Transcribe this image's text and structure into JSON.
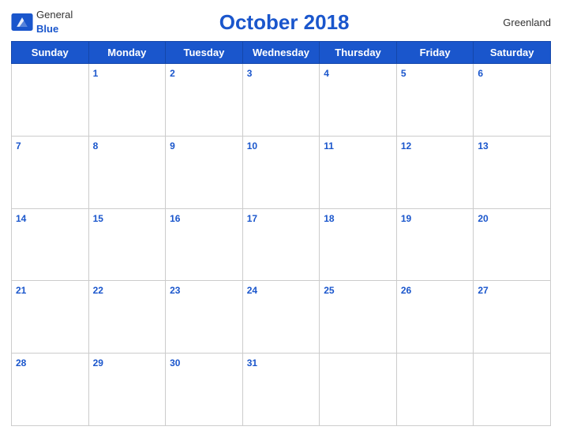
{
  "header": {
    "logo_general": "General",
    "logo_blue": "Blue",
    "title": "October 2018",
    "region": "Greenland"
  },
  "days_of_week": [
    "Sunday",
    "Monday",
    "Tuesday",
    "Wednesday",
    "Thursday",
    "Friday",
    "Saturday"
  ],
  "weeks": [
    [
      null,
      1,
      2,
      3,
      4,
      5,
      6
    ],
    [
      7,
      8,
      9,
      10,
      11,
      12,
      13
    ],
    [
      14,
      15,
      16,
      17,
      18,
      19,
      20
    ],
    [
      21,
      22,
      23,
      24,
      25,
      26,
      27
    ],
    [
      28,
      29,
      30,
      31,
      null,
      null,
      null
    ]
  ]
}
